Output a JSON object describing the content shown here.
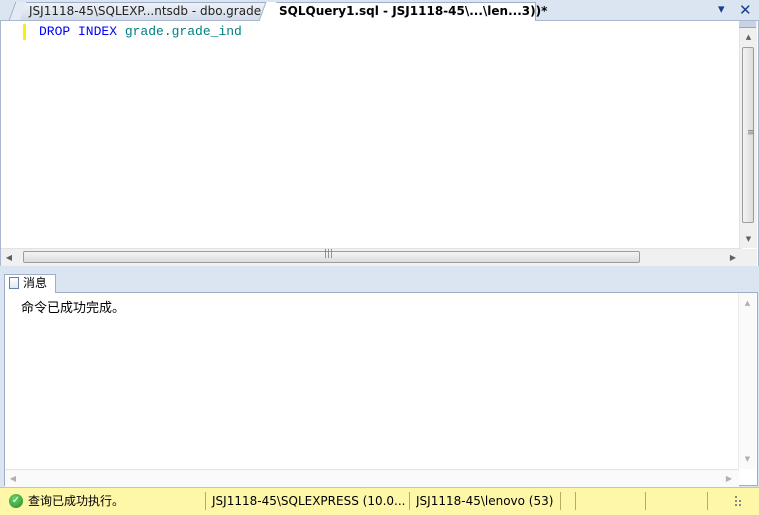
{
  "tabs": [
    {
      "label": "JSJ1118-45\\SQLEXP...ntsdb - dbo.grade",
      "active": false
    },
    {
      "label": "SQLQuery1.sql - JSJ1118-45\\...\\len...3))*",
      "active": true
    }
  ],
  "window_controls": {
    "pin_icon": "▾",
    "close_icon": "✕"
  },
  "editor": {
    "code_keyword": "DROP INDEX",
    "code_identifier": "grade.grade_ind"
  },
  "results": {
    "tab_label": "消息",
    "message": "命令已成功完成。"
  },
  "status_bar": {
    "status_text": "查询已成功执行。",
    "server": "JSJ1118-45\\SQLEXPRESS (10.0...",
    "user": "JSJ1118-45\\lenovo (53)"
  },
  "colors": {
    "keyword": "#0000ff",
    "identifier": "#008080",
    "status_bg": "#fff7a8",
    "chrome_bg": "#dbe4f1"
  }
}
